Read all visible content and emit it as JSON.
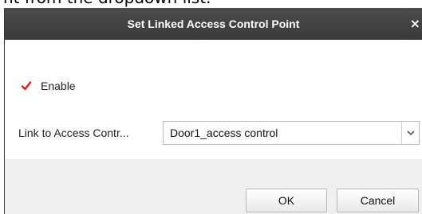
{
  "caption": {
    "text": "nt from the dropdown list."
  },
  "dialog": {
    "title": "Set Linked Access Control Point",
    "close_glyph": "×",
    "enable": {
      "label": "Enable",
      "checked": true,
      "check_color": "#d9201e"
    },
    "link": {
      "label": "Link to Access Contr...",
      "selected_value": "Door1_access control"
    },
    "buttons": {
      "ok": "OK",
      "cancel": "Cancel"
    }
  },
  "colors": {
    "titlebar": "#404040",
    "footer": "#f0f0f0"
  }
}
